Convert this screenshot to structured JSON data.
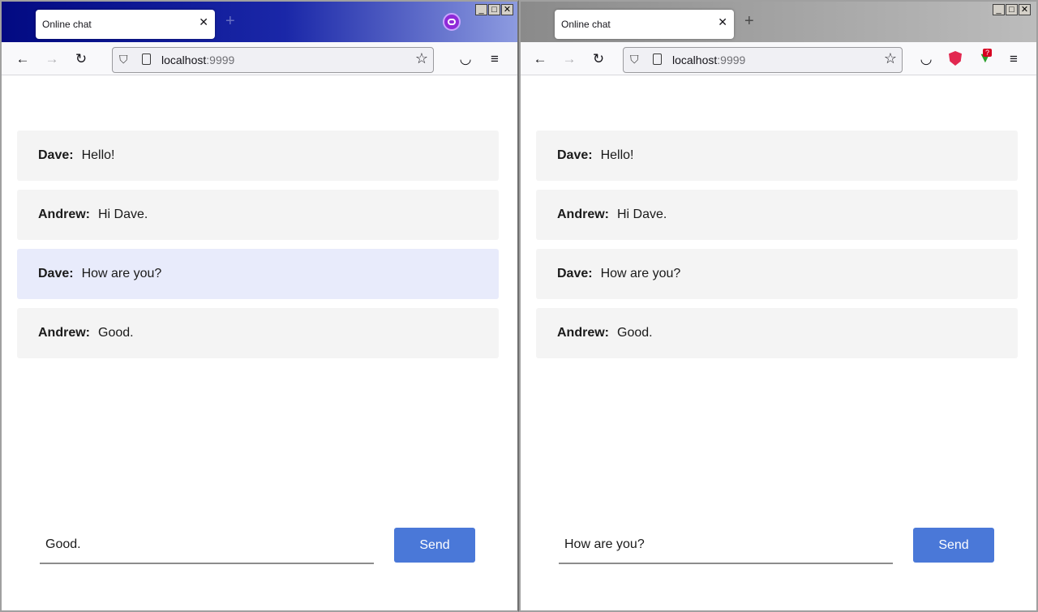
{
  "windows": [
    {
      "tab_title": "Online chat",
      "close_glyph": "✕",
      "new_tab_glyph": "+",
      "url_host": "localhost",
      "url_port": ":9999",
      "private_browsing": true,
      "messages": [
        {
          "author": "Dave:",
          "text": "Hello!",
          "highlighted": false
        },
        {
          "author": "Andrew:",
          "text": "Hi Dave.",
          "highlighted": false
        },
        {
          "author": "Dave:",
          "text": "How are you?",
          "highlighted": true
        },
        {
          "author": "Andrew:",
          "text": "Good.",
          "highlighted": false
        }
      ],
      "input_value": "Good.",
      "send_label": "Send"
    },
    {
      "tab_title": "Online chat",
      "close_glyph": "✕",
      "new_tab_glyph": "+",
      "url_host": "localhost",
      "url_port": ":9999",
      "private_browsing": false,
      "download_badge": "?",
      "messages": [
        {
          "author": "Dave:",
          "text": "Hello!",
          "highlighted": false
        },
        {
          "author": "Andrew:",
          "text": "Hi Dave.",
          "highlighted": false
        },
        {
          "author": "Dave:",
          "text": "How are you?",
          "highlighted": false
        },
        {
          "author": "Andrew:",
          "text": "Good.",
          "highlighted": false
        }
      ],
      "input_value": "How are you?",
      "send_label": "Send"
    }
  ],
  "window_controls": {
    "minimize": "_",
    "maximize": "□",
    "close": "✕"
  },
  "toolbar_icons": {
    "back": "←",
    "forward": "→",
    "reload": "↻",
    "star": "☆",
    "pocket": "◡",
    "menu": "≡",
    "shield": "⛉"
  },
  "colors": {
    "send_button": "#4a78d8",
    "message_bg": "#f4f4f4",
    "message_highlight": "#e8ebfb",
    "private_icon": "#8f2ad8"
  }
}
